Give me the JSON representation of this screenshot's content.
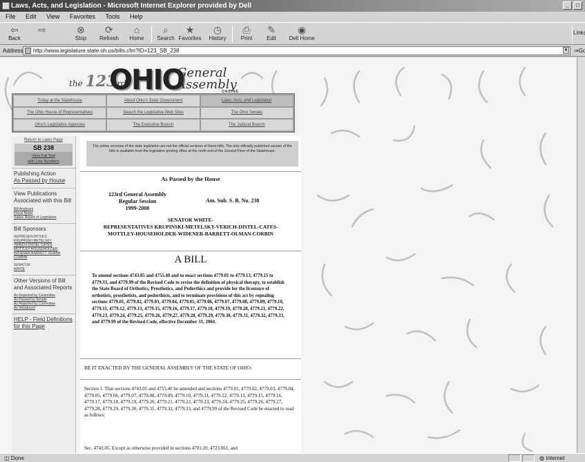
{
  "window": {
    "title": "Laws, Acts, and Legislation - Microsoft Internet Explorer provided by Dell"
  },
  "menu": [
    "File",
    "Edit",
    "View",
    "Favorites",
    "Tools",
    "Help"
  ],
  "toolbar": {
    "back": "Back",
    "forward": "",
    "stop": "Stop",
    "refresh": "Refresh",
    "home": "Home",
    "search": "Search",
    "favorites": "Favorites",
    "history": "History",
    "print": "Print",
    "edit": "Edit",
    "dellhome": "Dell Home",
    "links": "Links"
  },
  "address": {
    "label": "Address",
    "url": "http://www.legislature.state.oh.us/bills.cfm?ID=123_SB_238",
    "go": "Go"
  },
  "banner": {
    "the": "the",
    "num": "123",
    "rd": "rd",
    "ohio": "OHIO",
    "general": "General",
    "assembly": "Assembly",
    "online": "ONLINE"
  },
  "nav": [
    "Today at the Statehouse",
    "About Ohio's State Government",
    "Laws, Acts, and Legislation",
    "The Ohio House of Representatives",
    "Search the Legislative Web Sites",
    "The Ohio Senate",
    "Ohio's Legislative Agencies",
    "The Executive Branch",
    "The Judicial Branch"
  ],
  "sidebar": {
    "return": "Return to Laws Page",
    "bill": "SB 238",
    "fulltext_1": "View Full Text",
    "fulltext_2": "with Line Numbers",
    "publishing": "Publishing Action",
    "publishing_value": "As Passed by House",
    "view_pubs": "View Publications Associated with this Bill",
    "pub_links": [
      "Bill Analyses",
      "Fiscal Notes",
      "Status Report of Legislation"
    ],
    "sponsors_head": "Bill Sponsors",
    "rep_label": "REPRESENTATIVES:",
    "rep_names": "KRUPINSKI METELSKY VERICH DISTEL CATES MOTTLEY HOUSEHOLDER WIDENER BARRETT OLMAN CORBIN",
    "sen_label": "SENATOR",
    "sen_name": "WHITE",
    "other_versions": "Other Versions of Bill and Associated Reports",
    "version_links": [
      "As Reported by Committee",
      "As Passed by Senate",
      "As Reported by Committee",
      "As Introduced"
    ],
    "help": "HELP - Field Definitions for this Page"
  },
  "doc": {
    "notice": "The online versions of the state legislation are not the official versions of these bills. The only officially published version of the bills is available from the legislative printing office at the north end of the Ground Floor of the Statehouse.",
    "passed": "As Passed by the House",
    "assembly_1": "123rd General Assembly",
    "assembly_2": "Regular Session",
    "assembly_3": "1999-2000",
    "bill_no": "Am. Sub. S. B. No. 238",
    "sponsors_1": "SENATOR WHITE-",
    "sponsors_2": "REPRESENTATIVES KRUPINSKI-METELSKY-VERICH-DISTEL-CATES-",
    "sponsors_3": "MOTTLEY-HOUSEHOLDER-WIDENER-BARRETT-OLMAN-CORBIN",
    "a_bill": "A BILL",
    "title": "To amend sections 4743.05 and 4755.40 and to enact sections 4779.01 to 4779.13, 4779.15 to 4779.33, and 4779.99 of the Revised Code to revise the definition of physical therapy, to establish the State Board of Orthotics, Prosthetics, and Pedorthics and provide for the licensure of orthotists, prosthetists, and pedorthists, and to terminate provisions of this act by repealing sections 4779.01, 4779.02, 4779.03, 4779.04, 4779.05, 4779.06, 4779.07, 4779.08, 4779.09, 4779.10, 4779.11, 4779.12, 4779.13, 4779.15, 4779.16, 4779.17, 4779.18, 4779.19, 4779.20, 4779.21, 4779.22, 4779.23, 4779.24, 4779.25, 4779.26, 4779.27, 4779.28, 4779.29, 4779.30, 4779.31, 4779.32, 4779.33, and 4779.99 of the Revised Code, effective December 31, 2004.",
    "enacted": "BE IT ENACTED BY THE GENERAL ASSEMBLY OF THE STATE OF OHIO:",
    "section1": "Section 1. That sections 4743.05 and 4755.40 be amended and sections 4779.01, 4779.02, 4779.03, 4779.04, 4779.05, 4779.06, 4779.07, 4779.08, 4779.09, 4779.10, 4779.11, 4779.12, 4779.13, 4779.15, 4779.16, 4779.17, 4779.18, 4779.19, 4779.20, 4779.21, 4779.22, 4779.23, 4779.24, 4779.25, 4779.26, 4779.27, 4779.28, 4779.29, 4779.30, 4779.31, 4779.32, 4779.33, and 4779.99 of the Revised Code be enacted to read as follows:",
    "sec4743": "Sec. 4743.05. Except as otherwise provided in sections 4701.20, 4723.061, and"
  },
  "status": {
    "done": "Done",
    "zone": "Internet"
  }
}
